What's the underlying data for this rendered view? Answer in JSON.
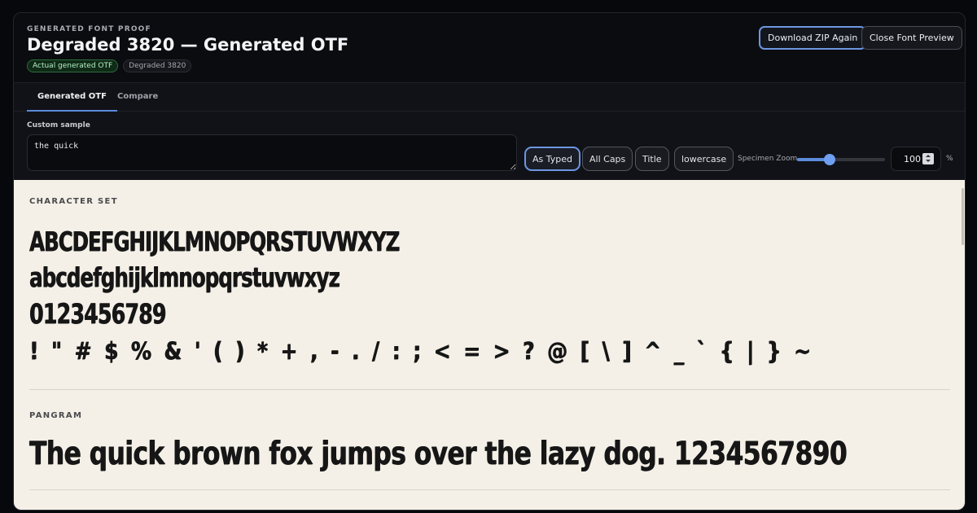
{
  "header": {
    "eyebrow": "GENERATED FONT PROOF",
    "title": "Degraded 3820 — Generated OTF",
    "badges": [
      "Actual generated OTF",
      "Degraded 3820"
    ],
    "download_label": "Download ZIP Again",
    "close_label": "Close Font Preview"
  },
  "tabs": [
    {
      "label": "Generated OTF",
      "active": true
    },
    {
      "label": "Compare",
      "active": false
    }
  ],
  "controls": {
    "sample_label": "Custom sample",
    "sample_value": "the quick",
    "case_buttons": [
      {
        "label": "As Typed",
        "active": true
      },
      {
        "label": "All Caps",
        "active": false
      },
      {
        "label": "Title",
        "active": false
      },
      {
        "label": "lowercase",
        "active": false
      }
    ],
    "zoom_label": "Specimen Zoom",
    "zoom_value": "100",
    "zoom_fraction": 0.37,
    "zoom_unit": "%"
  },
  "specimen": {
    "character_set_label": "CHARACTER SET",
    "uppercase": "ABCDEFGHIJKLMNOPQRSTUVWXYZ",
    "lowercase": "abcdefghijklmnopqrstuvwxyz",
    "digits": "0123456789",
    "symbols": "! \" # $ % & ' ( ) * + , - . / : ; < = > ? @ [ \\ ] ^ _ ` { | } ~",
    "pangram_label": "PANGRAM",
    "pangram": "The quick brown fox jumps over the lazy dog. 1234567890"
  },
  "colors": {
    "accent": "#5c8bdc",
    "specimen_bg": "#f4f0e7",
    "badge_green": "#2e6b3d"
  }
}
